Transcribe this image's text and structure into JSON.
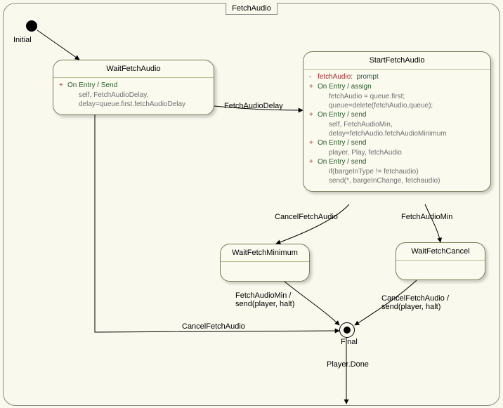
{
  "diagram": {
    "title": "FetchAudio",
    "initial_label": "Initial",
    "final_label": "Final",
    "states": {
      "wait_fetch_audio": {
        "title": "WaitFetchAudio",
        "entries": [
          {
            "label": "On Entry / Send",
            "sub": "self, FetchAudioDelay,\ndelay=queue.first.fetchAudioDelay"
          }
        ]
      },
      "start_fetch_audio": {
        "title": "StartFetchAudio",
        "attr": {
          "name": "fetchAudio:",
          "type": "prompt"
        },
        "entries": [
          {
            "label": "On Entry / assign",
            "sub": "fetchAudio = queue.first;\nqueue=delete(fetchAudio,queue);"
          },
          {
            "label": "On Entry / send",
            "sub": "self, FetchAudioMin,\ndelay=fetchAudio.fetchAudioMinimum"
          },
          {
            "label": "On Entry / send",
            "sub": "player, Play, fetchAudio"
          },
          {
            "label": "On Entry / send",
            "sub": "if(bargeInType != fetchaudio)\nsend(*, bargeInChange, fetchaudio)"
          }
        ]
      },
      "wait_fetch_minimum": {
        "title": "WaitFetchMinimum"
      },
      "wait_fetch_cancel": {
        "title": "WaitFetchCancel"
      }
    },
    "transitions": {
      "fetch_audio_delay": "FetchAudioDelay",
      "cancel_fetch_audio_1": "CancelFetchAudio",
      "fetch_audio_min_1": "FetchAudioMin",
      "fetch_audio_min_guard": "FetchAudioMin /\nsend(player, halt)",
      "cancel_fetch_audio_guard": "CancelFetchAudio /\nsend(player, halt)",
      "cancel_fetch_audio_2": "CancelFetchAudio",
      "player_done": "Player.Done"
    }
  }
}
